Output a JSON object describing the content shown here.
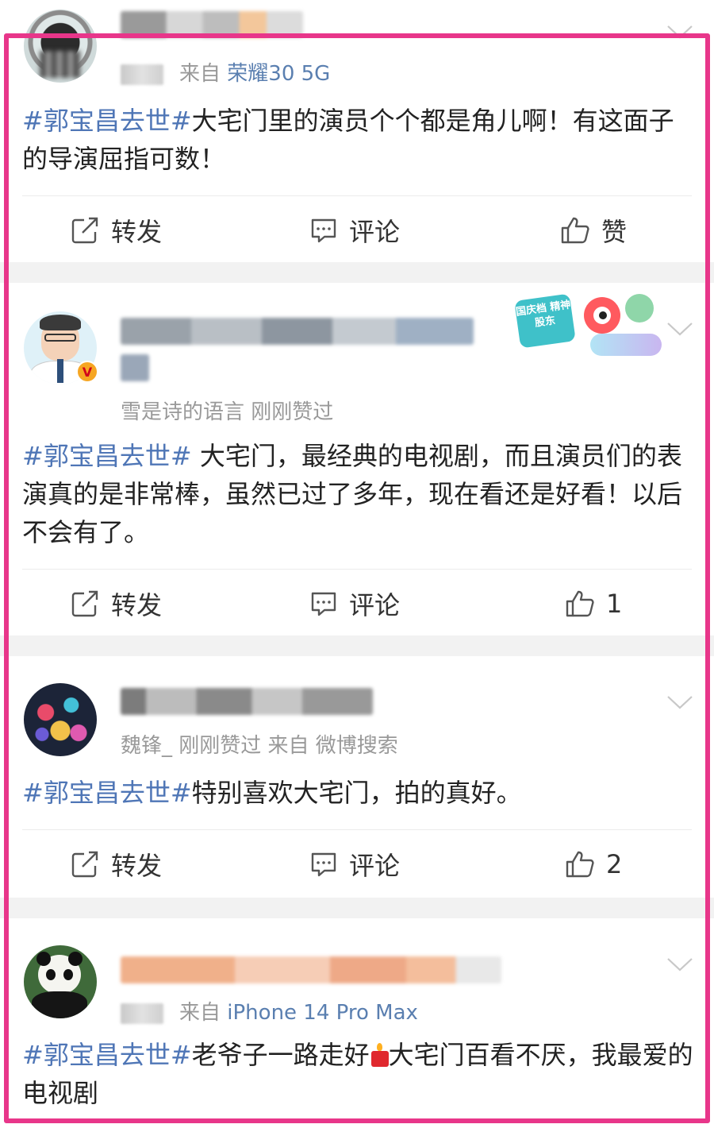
{
  "posts": [
    {
      "meta_prefix": "来自",
      "meta_source": "荣耀30 5G",
      "topic": "#郭宝昌去世#",
      "text": "大宅门里的演员个个都是角儿啊！有这面子的导演屈指可数！",
      "actions": {
        "repost": "转发",
        "comment": "评论",
        "like": "赞"
      }
    },
    {
      "meta_line": "雪是诗的语言 刚刚赞过",
      "topic": "#郭宝昌去世#",
      "text": " 大宅门，最经典的电视剧，而且演员们的表演真的是非常棒，虽然已过了多年，现在看还是好看！以后不会有了。",
      "badge": "国庆档 精神股东",
      "actions": {
        "repost": "转发",
        "comment": "评论",
        "like": "1"
      }
    },
    {
      "meta_line": "魏锋_ 刚刚赞过 来自 微博搜索",
      "topic": "#郭宝昌去世#",
      "text": "特别喜欢大宅门，拍的真好。",
      "actions": {
        "repost": "转发",
        "comment": "评论",
        "like": "2"
      }
    },
    {
      "meta_prefix": "来自",
      "meta_source": "iPhone 14 Pro Max",
      "topic": "#郭宝昌去世#",
      "text_before_emoji": "老爷子一路走好",
      "text_after_emoji": "大宅门百看不厌，我最爱的电视剧"
    }
  ],
  "colors": {
    "topic": "#4f76b6",
    "frame": "#e8368a",
    "meta": "#999999",
    "separator": "#f2f2f2"
  },
  "icons": [
    "repost-icon",
    "comment-icon",
    "like-icon",
    "chevron-down-icon",
    "verified-badge-icon",
    "candle-emoji-icon"
  ]
}
